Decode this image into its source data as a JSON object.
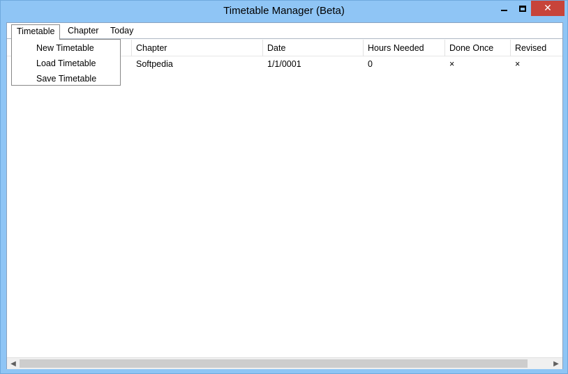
{
  "window": {
    "title": "Timetable Manager (Beta)",
    "close_glyph": "✕"
  },
  "menu": {
    "items": [
      {
        "label": "Timetable",
        "open": true
      },
      {
        "label": "Chapter"
      },
      {
        "label": "Today"
      }
    ],
    "timetable_dropdown": [
      "New Timetable",
      "Load Timetable",
      "Save Timetable"
    ]
  },
  "table": {
    "columns": [
      "Chapter",
      "Date",
      "Hours Needed",
      "Done Once",
      "Revised"
    ],
    "rows": [
      {
        "chapter": "Softpedia",
        "date": "1/1/0001",
        "hours": "0",
        "done": "×",
        "revised": "×"
      }
    ]
  },
  "scrollbar": {
    "left_glyph": "◀",
    "right_glyph": "▶"
  },
  "colors": {
    "window_frame": "#8fc5f5",
    "close_button": "#c7443a"
  }
}
